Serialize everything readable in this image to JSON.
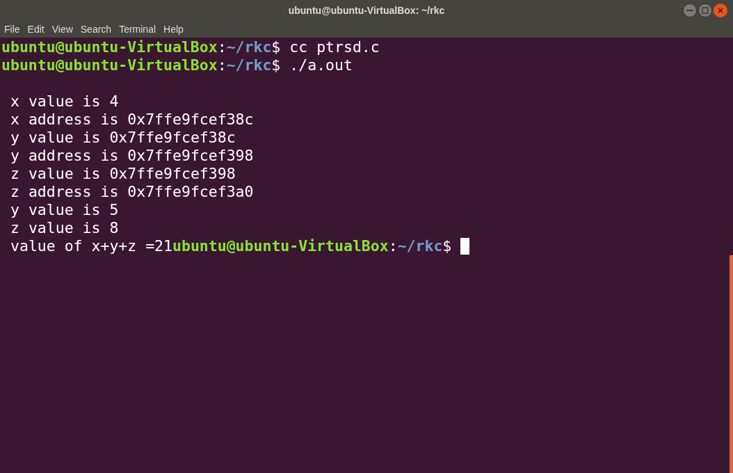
{
  "window": {
    "title": "ubuntu@ubuntu-VirtualBox: ~/rkc"
  },
  "menu": [
    "File",
    "Edit",
    "View",
    "Search",
    "Terminal",
    "Help"
  ],
  "lines": [
    {
      "kind": "prompt",
      "user_host": "ubuntu@ubuntu-VirtualBox",
      "colon": ":",
      "path": "~/rkc",
      "symbol": "$",
      "command": "cc ptrsd.c"
    },
    {
      "kind": "prompt",
      "user_host": "ubuntu@ubuntu-VirtualBox",
      "colon": ":",
      "path": "~/rkc",
      "symbol": "$",
      "command": "./a.out"
    },
    {
      "kind": "blank"
    },
    {
      "kind": "output",
      "text": "x value is 4"
    },
    {
      "kind": "output",
      "text": "x address is 0x7ffe9fcef38c"
    },
    {
      "kind": "output",
      "text": "y value is 0x7ffe9fcef38c"
    },
    {
      "kind": "output",
      "text": "y address is 0x7ffe9fcef398"
    },
    {
      "kind": "output",
      "text": "z value is 0x7ffe9fcef398"
    },
    {
      "kind": "output",
      "text": "z address is 0x7ffe9fcef3a0"
    },
    {
      "kind": "output",
      "text": "y value is 5"
    },
    {
      "kind": "output",
      "text": "z value is 8"
    },
    {
      "kind": "output",
      "text": "value of x+y+z =21",
      "prompt": {
        "user_host": "ubuntu@ubuntu-VirtualBox",
        "colon": ":",
        "path": "~/rkc",
        "symbol": "$",
        "cursor": true
      }
    }
  ]
}
